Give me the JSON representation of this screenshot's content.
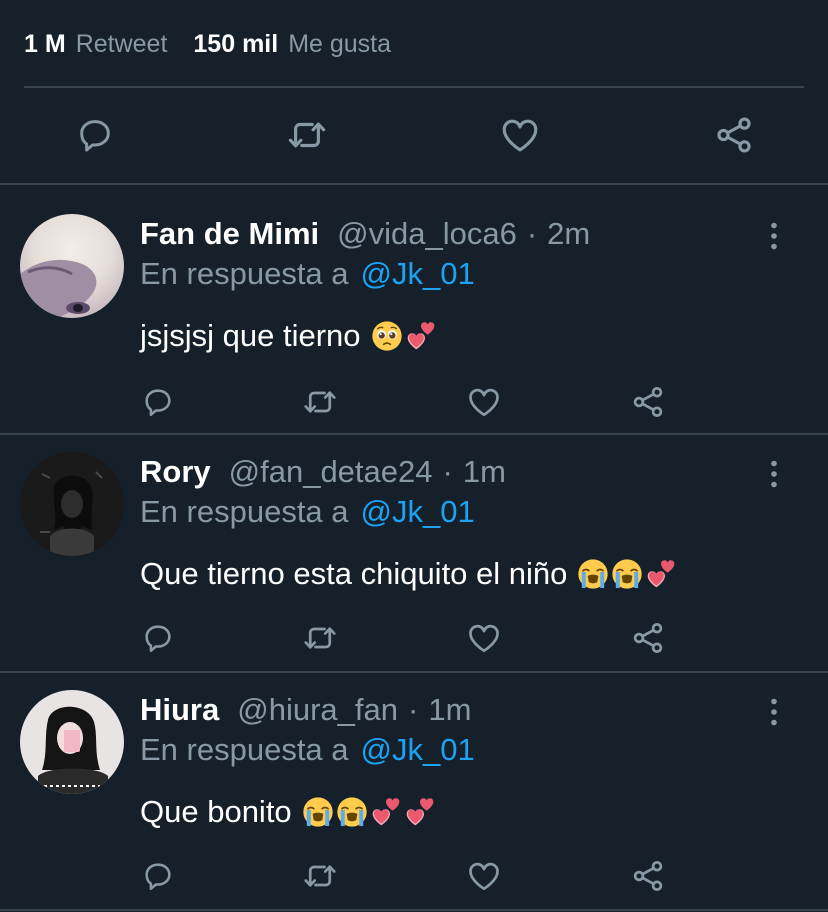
{
  "stats": {
    "retweets_count": "1 M",
    "retweets_label": "Retweet",
    "likes_count": "150 mil",
    "likes_label": "Me gusta"
  },
  "icons": {
    "reply": "reply-icon",
    "retweet": "retweet-icon",
    "like": "heart-icon",
    "share": "share-icon",
    "more": "more-vertical-icon"
  },
  "colors": {
    "background": "#15202b",
    "muted": "#8899a6",
    "link": "#1da1f2",
    "divider": "#38444d"
  },
  "replies": [
    {
      "name": "Fan de Mimi",
      "handle": "@vida_loca6",
      "separator": "·",
      "time": "2m",
      "reply_prefix": "En respuesta a",
      "reply_mention": "@Jk_01",
      "text": "jsjsjsj que tierno",
      "emojis": [
        "pleading-face",
        "two-hearts"
      ]
    },
    {
      "name": "Rory",
      "handle": "@fan_detae24",
      "separator": "·",
      "time": "1m",
      "reply_prefix": "En respuesta a",
      "reply_mention": "@Jk_01",
      "text": "Que tierno esta chiquito el niño",
      "emojis": [
        "loudly-crying-face",
        "loudly-crying-face",
        "two-hearts"
      ]
    },
    {
      "name": "Hiura",
      "handle": "@hiura_fan",
      "separator": "·",
      "time": "1m",
      "reply_prefix": "En respuesta a",
      "reply_mention": "@Jk_01",
      "text": "Que bonito",
      "emojis": [
        "loudly-crying-face",
        "loudly-crying-face",
        "two-hearts",
        "two-hearts"
      ]
    }
  ]
}
